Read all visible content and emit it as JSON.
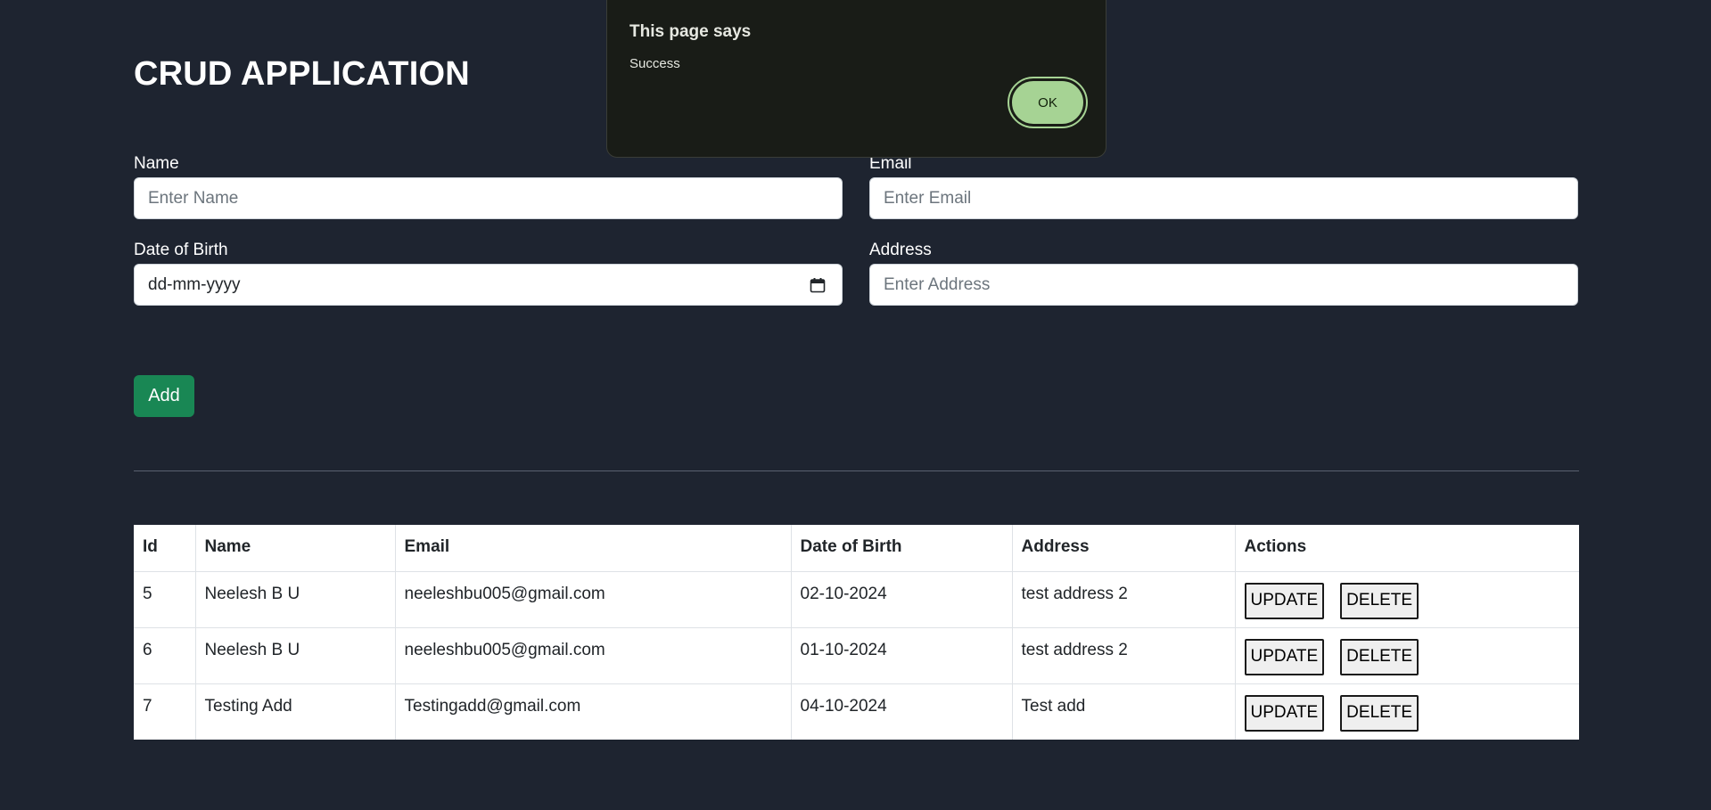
{
  "page": {
    "title": "CRUD APPLICATION"
  },
  "form": {
    "name": {
      "label": "Name",
      "placeholder": "Enter Name",
      "value": ""
    },
    "email": {
      "label": "Email",
      "placeholder": "Enter Email",
      "value": ""
    },
    "dob": {
      "label": "Date of Birth",
      "placeholder": "dd-mm-yyyy",
      "icon": "calendar-icon"
    },
    "address": {
      "label": "Address",
      "placeholder": "Enter Address",
      "value": ""
    },
    "add_label": "Add",
    "add_color": "#198754"
  },
  "table": {
    "headers": [
      "Id",
      "Name",
      "Email",
      "Date of Birth",
      "Address",
      "Actions"
    ],
    "rows": [
      {
        "id": "5",
        "name": "Neelesh B U",
        "email": "neeleshbu005@gmail.com",
        "dob": "02-10-2024",
        "address": "test address 2",
        "update": "UPDATE",
        "delete": "DELETE"
      },
      {
        "id": "6",
        "name": "Neelesh B U",
        "email": "neeleshbu005@gmail.com",
        "dob": "01-10-2024",
        "address": "test address 2",
        "update": "UPDATE",
        "delete": "DELETE"
      },
      {
        "id": "7",
        "name": "Testing Add",
        "email": "Testingadd@gmail.com",
        "dob": "04-10-2024",
        "address": "Test add",
        "update": "UPDATE",
        "delete": "DELETE"
      }
    ]
  },
  "alert": {
    "title": "This page says",
    "message": "Success",
    "ok_label": "OK",
    "ok_color": "#a6d394",
    "background": "#191c17"
  },
  "colors": {
    "page_background": "#1e2430",
    "text": "#ffffff"
  }
}
